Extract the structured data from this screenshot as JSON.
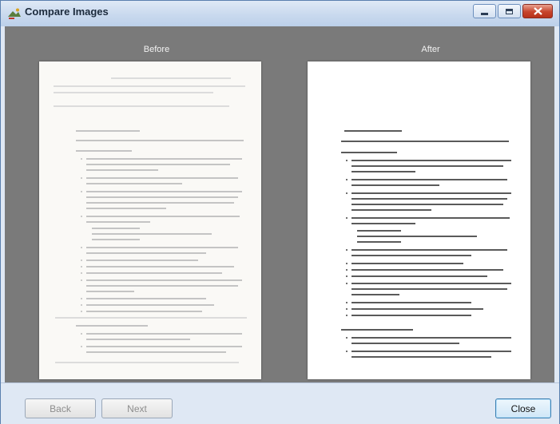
{
  "window": {
    "title": "Compare Images",
    "icon": "compare-images-icon"
  },
  "panels": {
    "before_label": "Before",
    "after_label": "After"
  },
  "buttons": {
    "back": "Back",
    "next": "Next",
    "close": "Close"
  },
  "colors": {
    "background": "#7a7a7a",
    "footer": "#dfe8f4",
    "titlebar": "#c9d9ee",
    "close_button": "#c7442c"
  }
}
